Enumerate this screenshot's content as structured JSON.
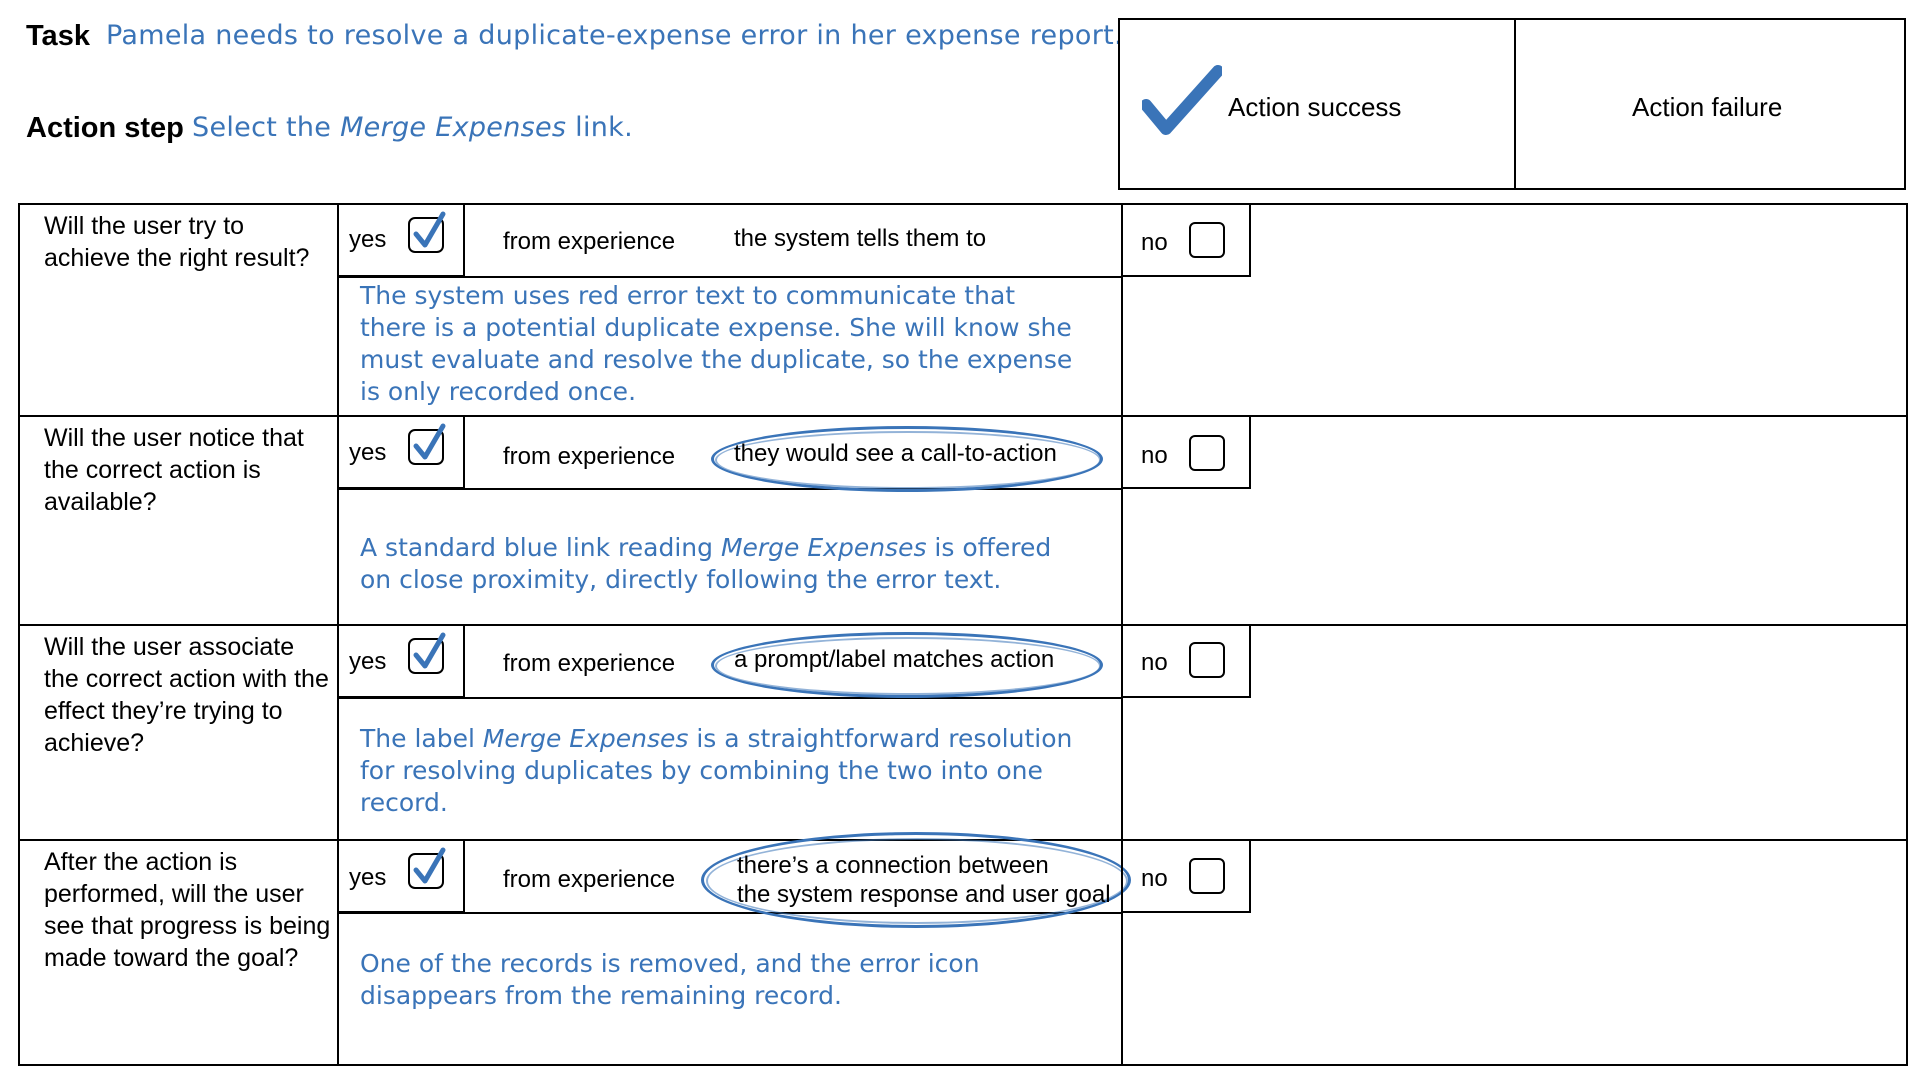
{
  "header": {
    "task_label": "Task",
    "task_text": "Pamela needs to resolve a duplicate-expense error in her expense report.",
    "action_label": "Action step",
    "action_prefix": "Select the ",
    "action_italic": "Merge Expenses",
    "action_suffix": " link."
  },
  "outcome": {
    "success_label": "Action success",
    "failure_label": "Action failure",
    "success_checked": true
  },
  "common": {
    "yes": "yes",
    "no": "no",
    "from_experience": "from experience"
  },
  "rows": [
    {
      "question": "Will the user try to achieve the right result?",
      "reason": "the system tells them to",
      "reason_circled": false,
      "note_parts": [
        "The system uses red error text to communicate that there is a potential duplicate expense. She will know she must evaluate and resolve the duplicate, so the expense is only recorded once."
      ]
    },
    {
      "question": "Will the user notice that the correct action is available?",
      "reason": "they would see a call-to-action",
      "reason_circled": true,
      "note_pre": "A standard blue link reading ",
      "note_italic": "Merge Expenses",
      "note_post_line1": " is offered",
      "note_line2": "on close proximity, directly following the error text."
    },
    {
      "question": "Will the user associate the correct action with the effect they’re trying to achieve?",
      "reason": "a prompt/label matches action",
      "reason_circled": true,
      "note_pre": "The label ",
      "note_italic": "Merge Expenses",
      "note_post_line1": " is a straightforward resolution",
      "note_line2": "for resolving duplicates by combining the two into one",
      "note_line3": "record."
    },
    {
      "question": "After the action is performed, will the user see that progress is being made toward the goal?",
      "reason_line1": "there’s a connection between",
      "reason_line2": "the system response and user goal",
      "reason_circled": true,
      "note_line1": "One of the records is removed, and the error icon",
      "note_line2": "disappears from the remaining record."
    }
  ]
}
